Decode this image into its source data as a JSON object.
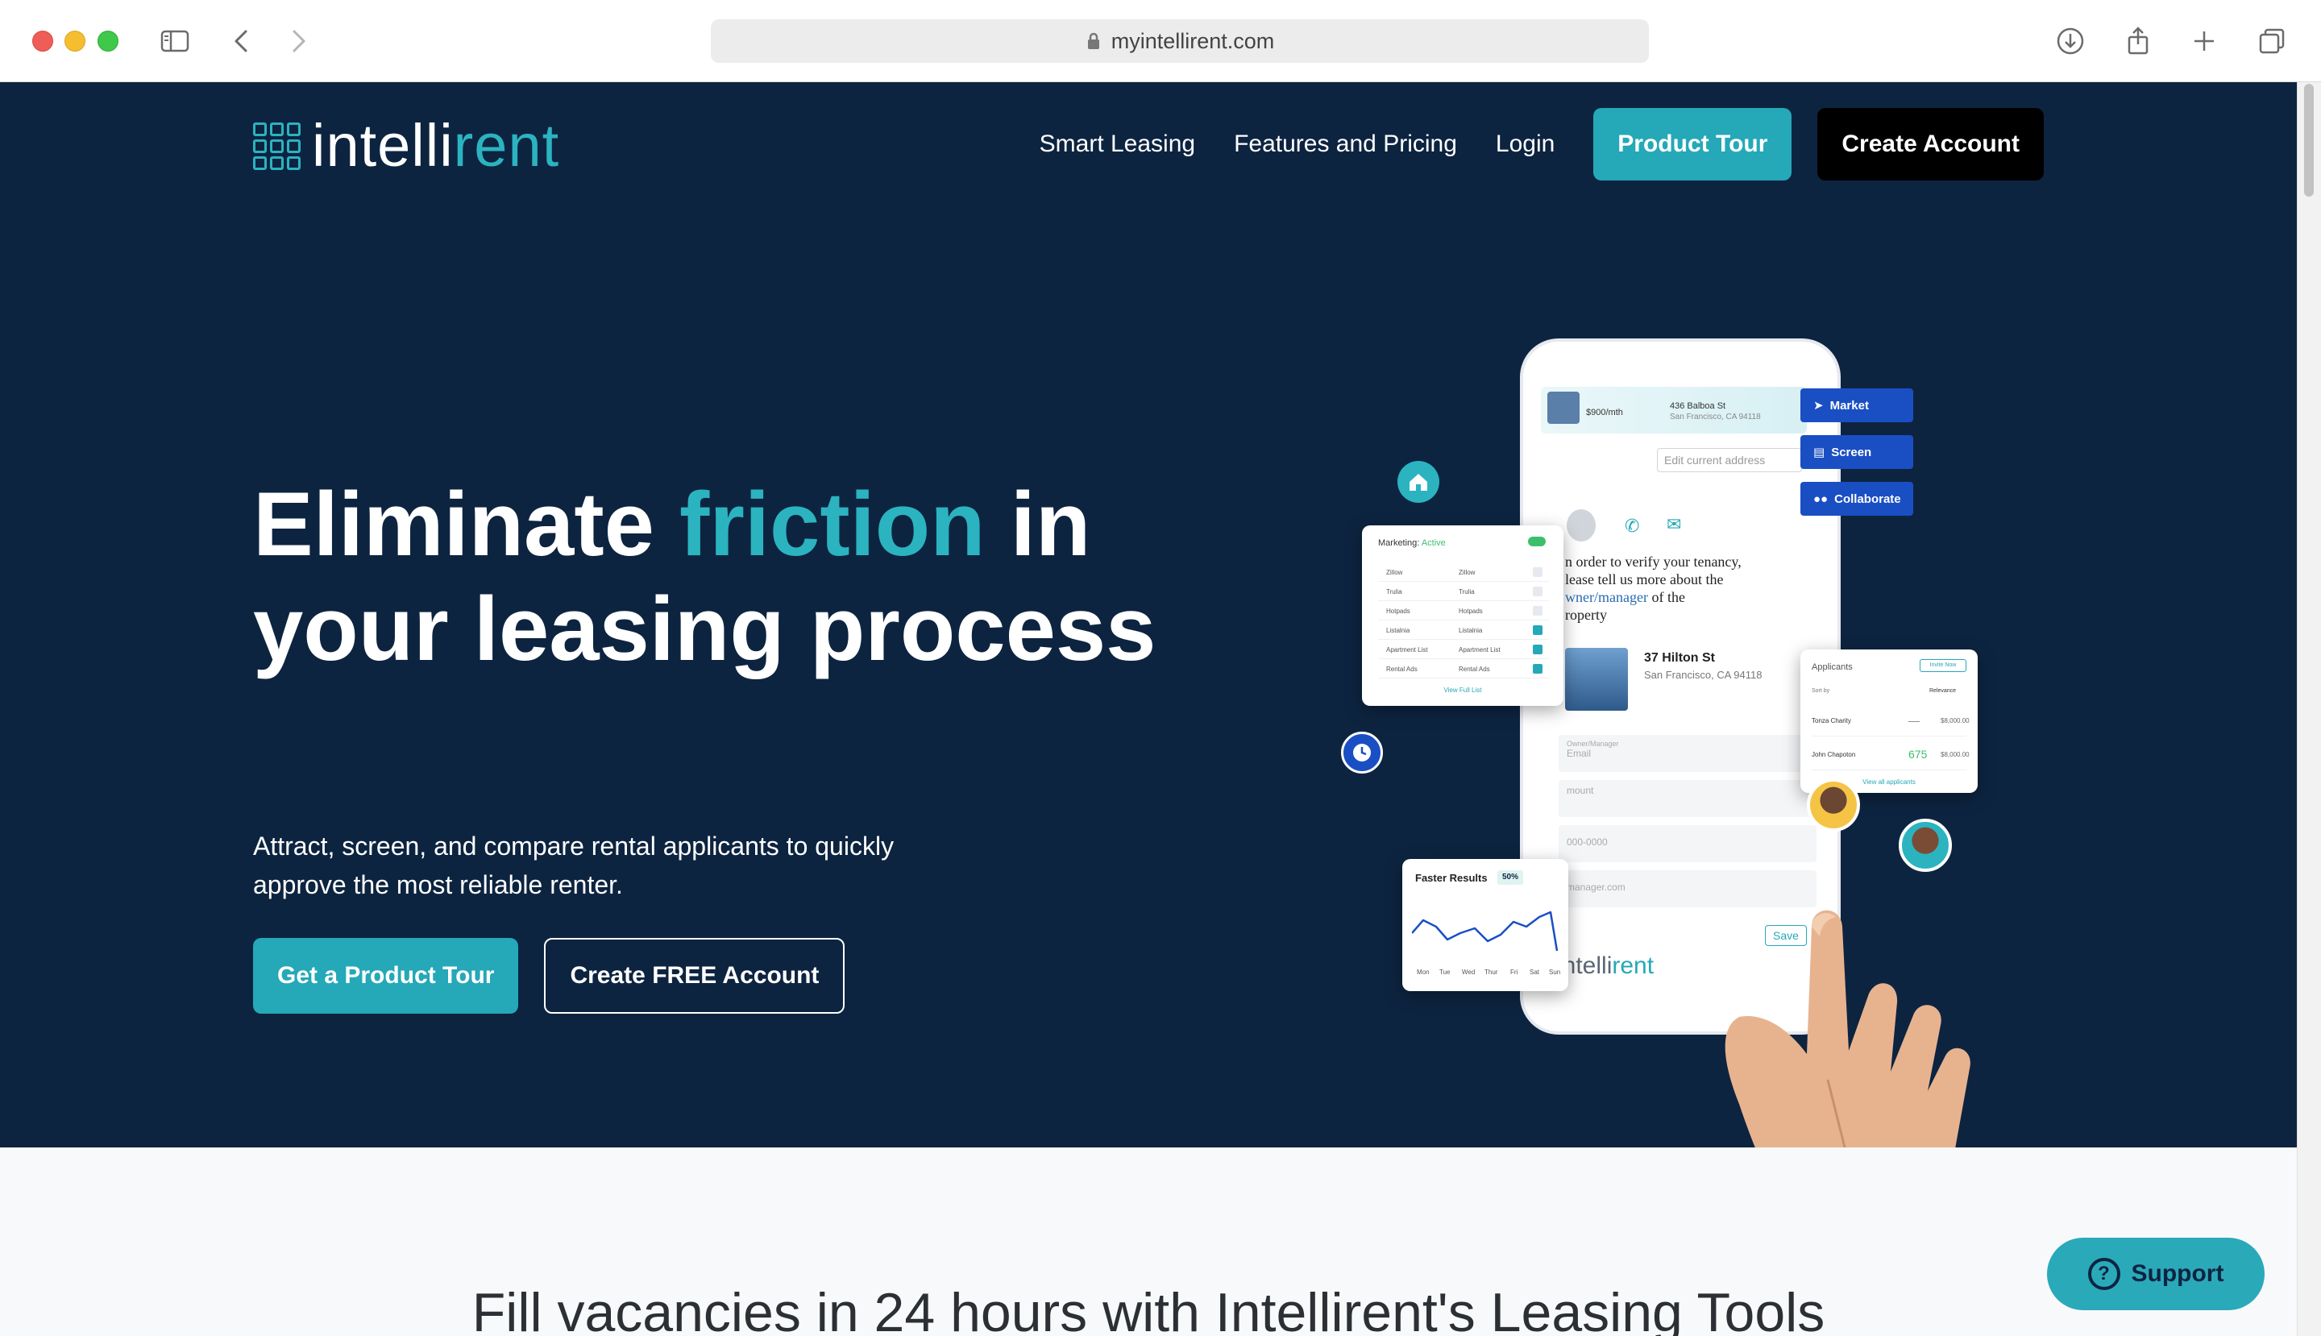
{
  "browser": {
    "url": "myintellirent.com"
  },
  "brand": {
    "logo_prefix": "intelli",
    "logo_suffix": "rent",
    "accent_color": "#2bb3c0",
    "navy_color": "#0d2440"
  },
  "nav": {
    "links": [
      "Smart Leasing",
      "Features and Pricing",
      "Login"
    ],
    "product_tour": "Product Tour",
    "create_account": "Create Account"
  },
  "hero": {
    "headline_1": "Eliminate ",
    "headline_highlight": "friction",
    "headline_2": " in your leasing process",
    "subhead": "Attract, screen, and compare rental applicants to quickly approve the most reliable renter.",
    "cta_primary": "Get a Product Tour",
    "cta_secondary": "Create FREE Account"
  },
  "illustration": {
    "listing_price": "$900/mth",
    "listing_address_1": "436 Balboa St",
    "listing_address_2": "San Francisco, CA 94118",
    "edit_address_placeholder": "Edit current address",
    "verify_text_1": "n order to verify your tenancy,",
    "verify_text_2": "lease tell us more about the",
    "verify_link": "wner/manager",
    "verify_text_3": " of the",
    "verify_text_4": "roperty",
    "property_address_1": "37 Hilton St",
    "property_address_2": "San Francisco, CA 94118",
    "field_owner": "Owner/Manager",
    "field_email": "Email",
    "field_amount": "mount",
    "field_phone": "000-0000",
    "field_email2": "manager.com",
    "save": "Save",
    "app_logo_prefix": "intelli",
    "app_logo_suffix": "rent",
    "tags": [
      "Market",
      "Screen",
      "Collaborate"
    ],
    "marketing": {
      "title": "Marketing: ",
      "status": "Active",
      "rows": [
        {
          "site": "Zillow",
          "label": "Zillow",
          "on": false
        },
        {
          "site": "Trulia",
          "label": "Trulia",
          "on": false
        },
        {
          "site": "Hotpads",
          "label": "Hotpads",
          "on": false
        },
        {
          "site": "Listalnia",
          "label": "Listalnia",
          "on": true
        },
        {
          "site": "Apartment List",
          "label": "Apartment List",
          "on": true
        },
        {
          "site": "Rental Ads",
          "label": "Rental Ads",
          "on": true
        }
      ],
      "footer": "View Full List"
    },
    "applicants": {
      "title": "Applicants",
      "invite": "Invite Now",
      "sort_label": "Sort by",
      "sort_value": "Relevance",
      "rows": [
        {
          "name": "Tonza Charity",
          "score": "—",
          "amount": "$8,000.00"
        },
        {
          "name": "John Chapoton",
          "score": "675",
          "amount": "$8,000.00"
        }
      ],
      "more": "View all applicants"
    },
    "faster": {
      "title": "Faster Results",
      "badge": "50%",
      "days": [
        "Mon",
        "Tue",
        "Wed",
        "Thur",
        "Fri",
        "Sat",
        "Sun"
      ]
    }
  },
  "section": {
    "title": "Fill vacancies in 24 hours with Intellirent's Leasing Tools"
  },
  "support": {
    "label": "Support"
  }
}
